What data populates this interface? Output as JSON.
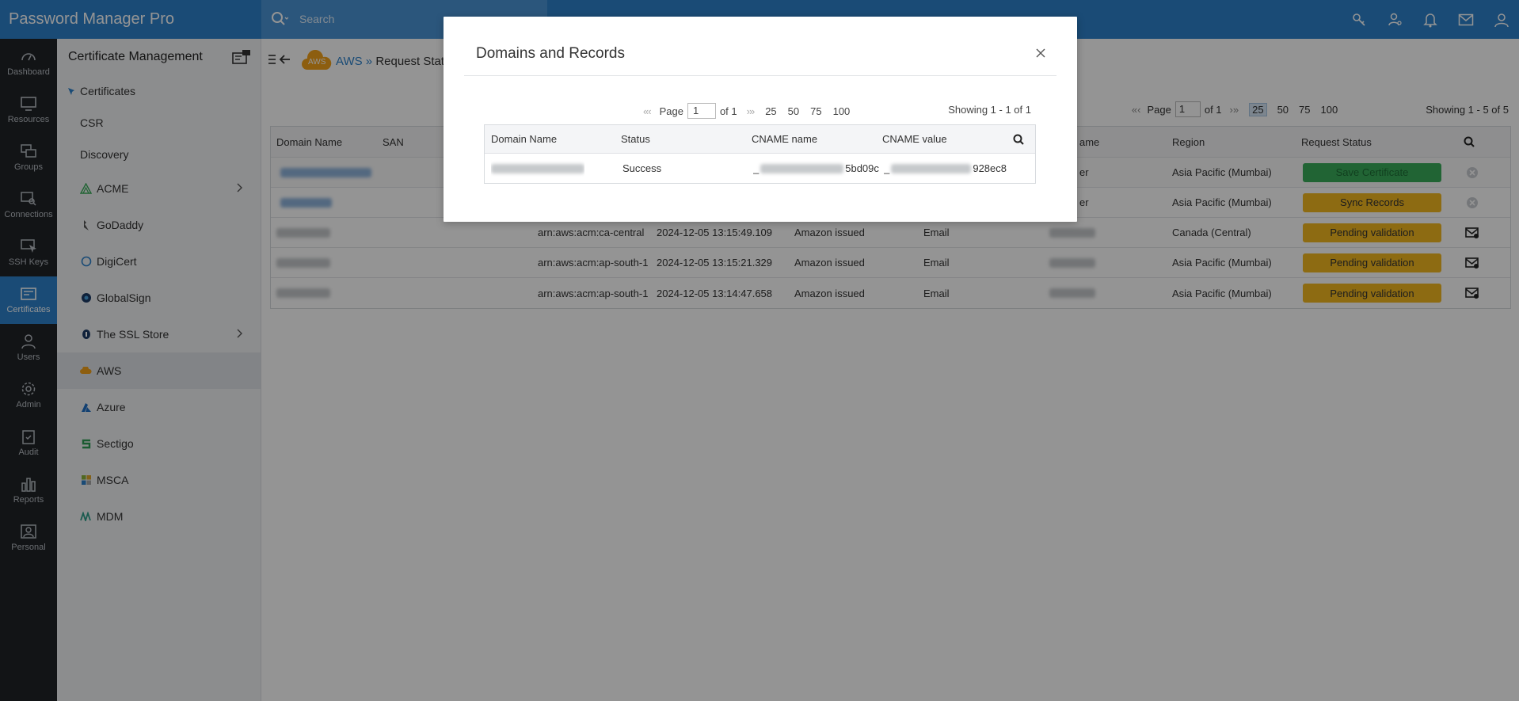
{
  "app": {
    "brand": "Password Manager Pro",
    "search_placeholder": "Search"
  },
  "rail": [
    {
      "label": "Dashboard",
      "icon": "dashboard-icon"
    },
    {
      "label": "Resources",
      "icon": "monitor-icon"
    },
    {
      "label": "Groups",
      "icon": "groups-icon"
    },
    {
      "label": "Connections",
      "icon": "connections-icon"
    },
    {
      "label": "SSH Keys",
      "icon": "key-icon"
    },
    {
      "label": "Certificates",
      "icon": "certificate-icon"
    },
    {
      "label": "Users",
      "icon": "user-icon"
    },
    {
      "label": "Admin",
      "icon": "gear-icon"
    },
    {
      "label": "Audit",
      "icon": "clipboard-icon"
    },
    {
      "label": "Reports",
      "icon": "bar-chart-icon"
    },
    {
      "label": "Personal",
      "icon": "personal-icon"
    }
  ],
  "subnav": {
    "title": "Certificate Management",
    "items": {
      "certificates": "Certificates",
      "csr": "CSR",
      "discovery": "Discovery",
      "acme": "ACME",
      "godaddy": "GoDaddy",
      "digicert": "DigiCert",
      "globalsign": "GlobalSign",
      "sslstore": "The SSL Store",
      "aws": "AWS",
      "azure": "Azure",
      "sectigo": "Sectigo",
      "msca": "MSCA",
      "mdm": "MDM"
    }
  },
  "breadcrumb": {
    "cloud_label": "AWS",
    "root": "AWS",
    "sep": "»",
    "current": "Request Stat"
  },
  "main_pager": {
    "page_label": "Page",
    "page_value": "1",
    "of_label": "of 1",
    "sizes": [
      "25",
      "50",
      "75",
      "100"
    ],
    "showing": "Showing 1 - 5 of 5"
  },
  "main_table": {
    "headers": {
      "domain": "Domain Name",
      "san": "SAN",
      "owner": "ame",
      "region": "Region",
      "status": "Request Status"
    },
    "rows": [
      {
        "arn": "",
        "date": "",
        "type": "",
        "validation": "",
        "owner": "er",
        "region": "Asia Pacific (Mumbai)",
        "status": "Save Certificate"
      },
      {
        "arn": "",
        "date": "",
        "type": "",
        "validation": "",
        "owner": "er",
        "region": "Asia Pacific (Mumbai)",
        "status": "Sync Records"
      },
      {
        "arn": "arn:aws:acm:ca-central",
        "date": "2024-12-05 13:15:49.109",
        "type": "Amazon issued",
        "validation": "Email",
        "owner": "",
        "region": "Canada (Central)",
        "status": "Pending validation"
      },
      {
        "arn": "arn:aws:acm:ap-south-1",
        "date": "2024-12-05 13:15:21.329",
        "type": "Amazon issued",
        "validation": "Email",
        "owner": "",
        "region": "Asia Pacific (Mumbai)",
        "status": "Pending validation"
      },
      {
        "arn": "arn:aws:acm:ap-south-1",
        "date": "2024-12-05 13:14:47.658",
        "type": "Amazon issued",
        "validation": "Email",
        "owner": "",
        "region": "Asia Pacific (Mumbai)",
        "status": "Pending validation"
      }
    ]
  },
  "modal": {
    "title": "Domains and Records",
    "close": "×",
    "pager": {
      "page_label": "Page",
      "page_value": "1",
      "of_label": "of 1",
      "sizes": [
        "25",
        "50",
        "75",
        "100"
      ],
      "showing": "Showing 1 - 1 of 1"
    },
    "headers": {
      "domain": "Domain Name",
      "status": "Status",
      "cname_name": "CNAME name",
      "cname_value": "CNAME value"
    },
    "row": {
      "status": "Success",
      "cname_name_prefix": "_",
      "cname_name_tail": "5bd09c",
      "cname_value_prefix": "_",
      "cname_value_tail": "928ec8"
    }
  },
  "colors": {
    "brand_blue": "#2d82cc",
    "rail_bg": "#1f2327",
    "success_green": "#3aad5b",
    "pending_amber": "#f3b820"
  }
}
